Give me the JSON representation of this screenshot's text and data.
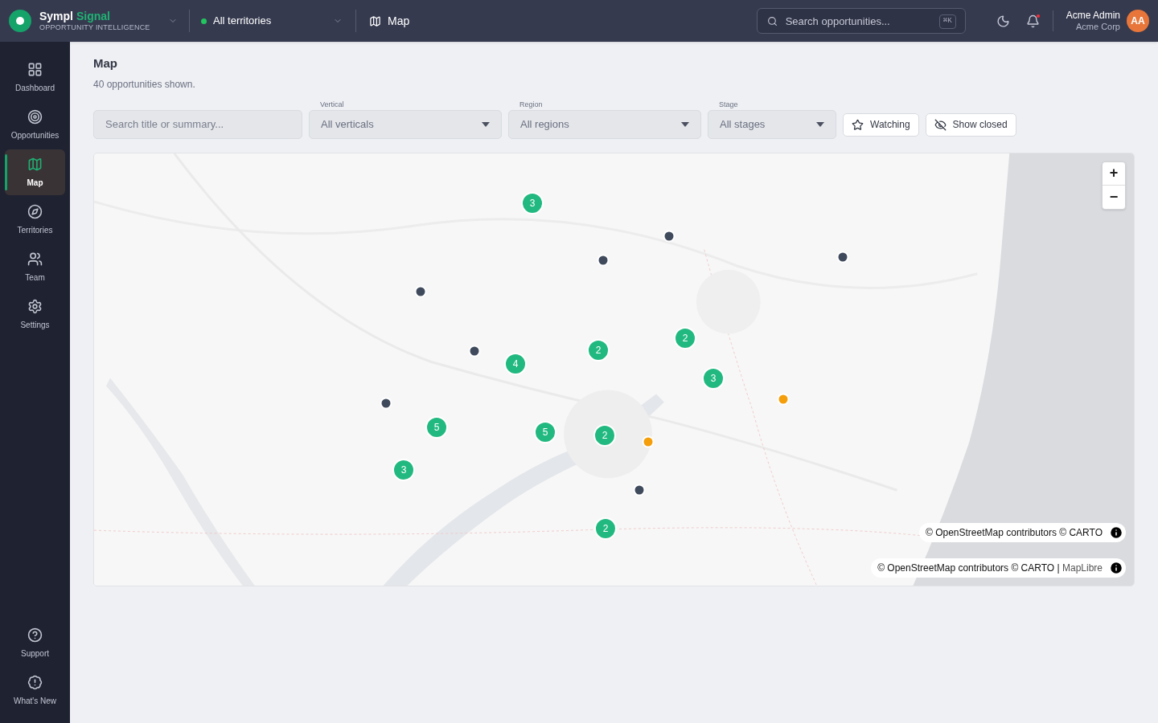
{
  "header": {
    "brand": {
      "name": "Sympl",
      "accent": "Signal",
      "tagline": "OPPORTUNITY INTELLIGENCE"
    },
    "territory": {
      "label": "All territories",
      "color": "#22c55e"
    },
    "page_crumb": "Map",
    "search": {
      "placeholder": "Search opportunities...",
      "shortcut": "⌘K"
    },
    "notifications": {
      "unread": true
    },
    "user": {
      "name": "Acme Admin",
      "org": "Acme Corp",
      "initials": "AA"
    }
  },
  "sidebar": {
    "items": [
      {
        "label": "Dashboard",
        "selected": false
      },
      {
        "label": "Opportunities",
        "selected": false
      },
      {
        "label": "Map",
        "selected": true
      },
      {
        "label": "Territories",
        "selected": false
      },
      {
        "label": "Team",
        "selected": false
      },
      {
        "label": "Settings",
        "selected": false
      }
    ],
    "bottom_items": [
      {
        "label": "Support"
      },
      {
        "label": "What's New"
      }
    ]
  },
  "page": {
    "title": "Map",
    "subtitle": "40 opportunities shown."
  },
  "filters": {
    "search": {
      "placeholder": "Search title or summary..."
    },
    "selects": [
      {
        "label": "Vertical",
        "value": "All verticals"
      },
      {
        "label": "Region",
        "value": "All regions"
      },
      {
        "label": "Stage",
        "value": "All stages"
      }
    ],
    "toggles": [
      {
        "label": "Watching",
        "on": false
      },
      {
        "label": "Show closed",
        "on": false
      }
    ]
  },
  "map": {
    "markers": [
      {
        "kind": "cluster",
        "count": "3"
      },
      {
        "kind": "point",
        "color": "#3f4a5c"
      },
      {
        "kind": "point",
        "color": "#3f4a5c"
      },
      {
        "kind": "point",
        "color": "#3f4a5c"
      },
      {
        "kind": "point",
        "color": "#3f4a5c"
      },
      {
        "kind": "cluster",
        "count": "2"
      },
      {
        "kind": "cluster",
        "count": "2"
      },
      {
        "kind": "point",
        "color": "#3f4a5c"
      },
      {
        "kind": "cluster",
        "count": "4"
      },
      {
        "kind": "cluster",
        "count": "3"
      },
      {
        "kind": "point",
        "color": "#f59e0b"
      },
      {
        "kind": "point",
        "color": "#3f4a5c"
      },
      {
        "kind": "cluster",
        "count": "5"
      },
      {
        "kind": "cluster",
        "count": "5"
      },
      {
        "kind": "cluster",
        "count": "2"
      },
      {
        "kind": "point",
        "color": "#f59e0b"
      },
      {
        "kind": "cluster",
        "count": "3"
      },
      {
        "kind": "point",
        "color": "#3f4a5c"
      },
      {
        "kind": "cluster",
        "count": "2"
      }
    ],
    "zoom": {
      "in": "+",
      "out": "−"
    },
    "attributions": [
      {
        "text": "© OpenStreetMap contributors © CARTO"
      },
      {
        "text": "© OpenStreetMap contributors © CARTO",
        "separator": "|",
        "link": "MapLibre"
      }
    ]
  }
}
